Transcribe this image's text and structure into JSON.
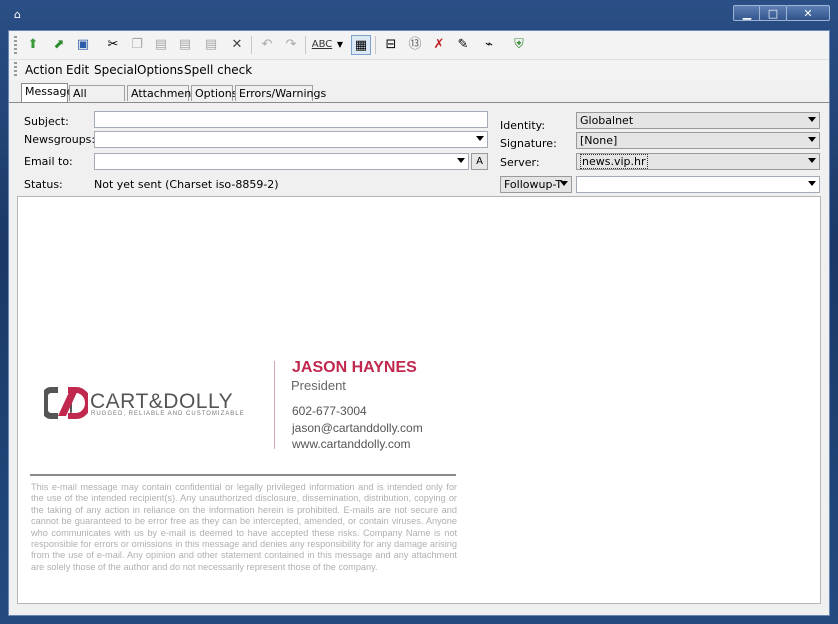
{
  "window": {
    "system_icon": "home-icon",
    "buttons": {
      "minimize": "▁",
      "maximize": "□",
      "close": "✕"
    }
  },
  "toolbar": {
    "icons": [
      "send-icon",
      "send-later-icon",
      "save-icon",
      "cut-icon",
      "copy-icon",
      "paste-icon",
      "paste-quote-icon",
      "paste-special-icon",
      "delete-icon",
      "undo-icon",
      "redo-icon",
      "spell-check-icon",
      "insert-icon",
      "attach-icon",
      "rot13-icon",
      "remove-icon",
      "signature-icon",
      "wrap-icon",
      "pgp-icon"
    ]
  },
  "menu": [
    "Action",
    "Edit",
    "Special",
    "Options",
    "Spell check"
  ],
  "tabs": [
    "Message",
    "All headers",
    "Attachments",
    "Options",
    "Errors/Warnings"
  ],
  "form": {
    "subject_label": "Subject:",
    "subject_value": "",
    "newsgroups_label": "Newsgroups:",
    "newsgroups_value": "",
    "emailto_label": "Email to:",
    "emailto_value": "",
    "address_button": "A",
    "status_label": "Status:",
    "status_value": "Not yet sent (Charset iso-8859-2)",
    "identity_label": "Identity:",
    "identity_value": "Globalnet",
    "signature_label": "Signature:",
    "signature_value": "[None]",
    "server_label": "Server:",
    "server_value": "news.vip.hr",
    "followup_value": "Followup-T",
    "followup_field": ""
  },
  "signature": {
    "logo_text": "CART&DOLLY",
    "tagline": "RUGGED, RELIABLE AND CUSTOMIZABLE",
    "name": "JASON HAYNES",
    "title": "President",
    "phone": "602-677-3004",
    "email": "jason@cartanddolly.com",
    "website": "www.cartanddolly.com",
    "disclaimer": "This e-mail message may contain confidential or legally privileged information and is intended only for the use of the intended recipient(s). Any unauthorized disclosure, dissemination, distribution, copying or the taking of any action in reliance on the information herein is prohibited. E-mails are not secure and cannot be guaranteed to be error free as they can be intercepted, amended, or contain viruses. Anyone who communicates with us by e-mail is deemed to have accepted these risks. Company Name is not responsible for errors or omissions in this message and denies any responsibility for any damage arising from the use of e-mail. Any opinion and other statement contained in this message and any attachment are solely those of the author and do not necessarily represent those of the company.",
    "brand_color": "#c0284e"
  }
}
